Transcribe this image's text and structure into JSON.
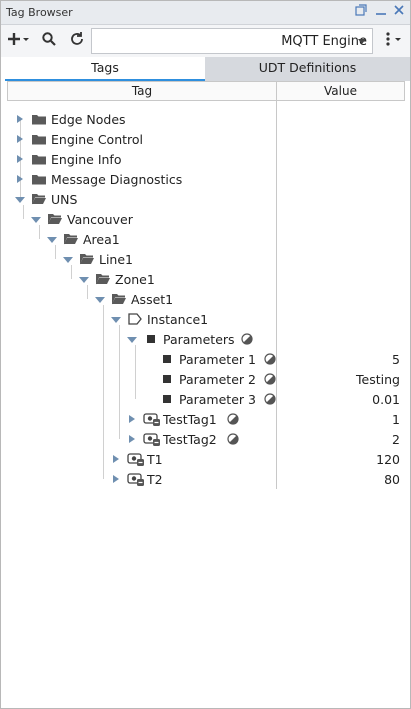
{
  "window": {
    "title": "Tag Browser"
  },
  "toolbar": {
    "provider": "MQTT Engine"
  },
  "tabs": [
    "Tags",
    "UDT Definitions"
  ],
  "columns": {
    "tag": "Tag",
    "value": "Value"
  },
  "tree": [
    {
      "label": "Edge Nodes",
      "value": "",
      "icon": "folder-icon",
      "state": "collapsed"
    },
    {
      "label": "Engine Control",
      "value": "",
      "icon": "folder-icon",
      "state": "collapsed"
    },
    {
      "label": "Engine Info",
      "value": "",
      "icon": "folder-icon",
      "state": "collapsed"
    },
    {
      "label": "Message Diagnostics",
      "value": "",
      "icon": "folder-icon",
      "state": "collapsed"
    },
    {
      "label": "UNS",
      "value": "",
      "icon": "folder-open-icon",
      "state": "expanded"
    },
    {
      "label": "Vancouver",
      "value": "",
      "icon": "folder-open-icon",
      "state": "expanded"
    },
    {
      "label": "Area1",
      "value": "",
      "icon": "folder-open-icon",
      "state": "expanded"
    },
    {
      "label": "Line1",
      "value": "",
      "icon": "folder-open-icon",
      "state": "expanded"
    },
    {
      "label": "Zone1",
      "value": "",
      "icon": "folder-open-icon",
      "state": "expanded"
    },
    {
      "label": "Asset1",
      "value": "",
      "icon": "folder-open-icon",
      "state": "expanded"
    },
    {
      "label": "Instance1",
      "value": "",
      "icon": "udt-instance-icon",
      "state": "expanded"
    },
    {
      "label": "Parameters",
      "value": "",
      "icon": "parameter-icon",
      "state": "expanded",
      "status": true
    },
    {
      "label": "Parameter 1",
      "value": "5",
      "icon": "parameter-icon",
      "state": "leaf",
      "status": true
    },
    {
      "label": "Parameter 2",
      "value": "Testing",
      "icon": "parameter-icon",
      "state": "leaf",
      "status": true
    },
    {
      "label": "Parameter 3",
      "value": "0.01",
      "icon": "parameter-icon",
      "state": "leaf",
      "status": true
    },
    {
      "label": "TestTag1",
      "value": "1",
      "icon": "tag-icon",
      "state": "collapsed",
      "status": true
    },
    {
      "label": "TestTag2",
      "value": "2",
      "icon": "tag-icon",
      "state": "collapsed",
      "status": true
    },
    {
      "label": "T1",
      "value": "120",
      "icon": "tag-icon",
      "state": "collapsed"
    },
    {
      "label": "T2",
      "value": "80",
      "icon": "tag-icon",
      "state": "collapsed"
    }
  ],
  "colors": {
    "accent": "#2e8fde",
    "folder": "#5a5a5a",
    "expander": "#6f8fb0"
  }
}
